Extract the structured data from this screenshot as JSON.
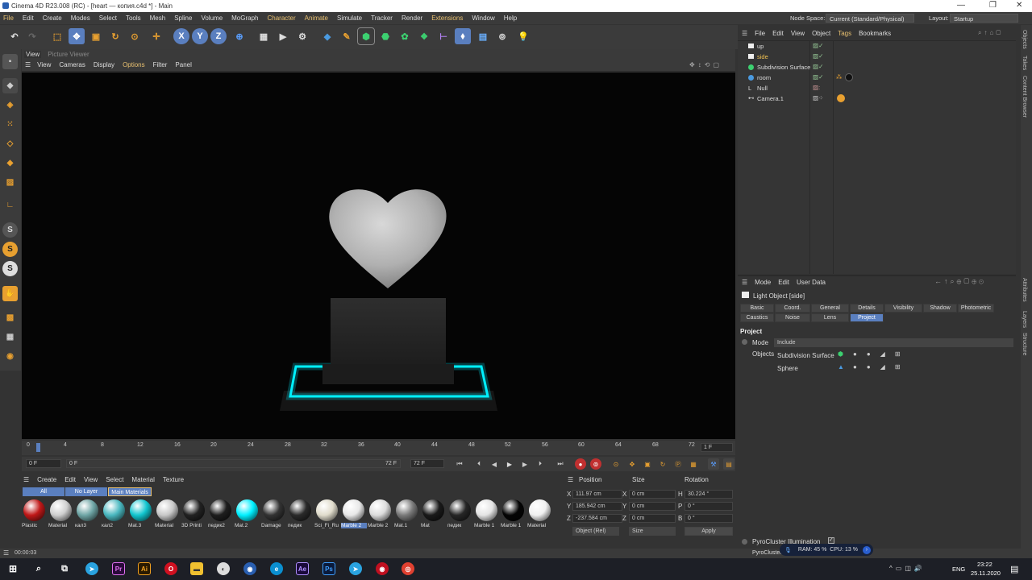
{
  "app": {
    "title": "Cinema 4D R23.008 (RC) - [heart — копия.c4d *] - Main",
    "window_controls": [
      "—",
      "❐",
      "✕"
    ]
  },
  "menu": [
    "File",
    "Edit",
    "Create",
    "Modes",
    "Select",
    "Tools",
    "Mesh",
    "Spline",
    "Volume",
    "MoGraph",
    "Character",
    "Animate",
    "Simulate",
    "Tracker",
    "Render",
    "Extensions",
    "Window",
    "Help"
  ],
  "node_space": {
    "label": "Node Space:",
    "value": "Current (Standard/Physical)"
  },
  "layout": {
    "label": "Layout:",
    "value": "Startup"
  },
  "toolbar": {
    "x": "X",
    "y": "Y",
    "z": "Z"
  },
  "view_tabs": [
    "View",
    "Picture Viewer"
  ],
  "view_menu": [
    "View",
    "Cameras",
    "Display",
    "Options",
    "Filter",
    "Panel"
  ],
  "timeline": {
    "ticks": [
      "0",
      "4",
      "8",
      "12",
      "16",
      "20",
      "24",
      "28",
      "32",
      "36",
      "40",
      "44",
      "48",
      "52",
      "56",
      "60",
      "64",
      "68",
      "72"
    ],
    "current_frame": "1 F"
  },
  "playbar": {
    "start": "0 F",
    "min": "0 F",
    "max": "72 F",
    "end": "72 F"
  },
  "materials": {
    "menu": [
      "Create",
      "Edit",
      "View",
      "Select",
      "Material",
      "Texture"
    ],
    "filters": [
      "All",
      "No Layer",
      "Main Materials"
    ],
    "items": [
      {
        "name": "Plastic",
        "color": "#c01818"
      },
      {
        "name": "Material",
        "color": "#cfcfcf"
      },
      {
        "name": "кал3",
        "color": "#6fa6a6"
      },
      {
        "name": "кал2",
        "color": "#4ab8c0"
      },
      {
        "name": "Mat.3",
        "color": "#12c6cf"
      },
      {
        "name": "Material",
        "color": "#c8c8c8"
      },
      {
        "name": "3D Printi",
        "color": "#222222"
      },
      {
        "name": "педик2",
        "color": "#1e1e1e"
      },
      {
        "name": "Mat.2",
        "color": "#00f0ff"
      },
      {
        "name": "Damage",
        "color": "#333333"
      },
      {
        "name": "педик",
        "color": "#2a2a2a"
      },
      {
        "name": "Sci_Fi_Ru",
        "color": "#e0dccc"
      },
      {
        "name": "Marble 2",
        "color": "#e8e8e8"
      },
      {
        "name": "Marble 2",
        "color": "#dcdcdc"
      },
      {
        "name": "Mat.1",
        "color": "#7a7a7a"
      },
      {
        "name": "Mat",
        "color": "#1a1a1a"
      },
      {
        "name": "педик",
        "color": "#262626"
      },
      {
        "name": "Marble 1",
        "color": "#e4e4e4"
      },
      {
        "name": "Marble 1",
        "color": "#050505"
      },
      {
        "name": "Material",
        "color": "#f0f0f0"
      }
    ]
  },
  "coords": {
    "headers": [
      "Position",
      "Size",
      "Rotation"
    ],
    "rows": [
      {
        "a": "X",
        "pos": "111.97 cm",
        "b": "X",
        "size": "0 cm",
        "c": "H",
        "rot": "30.224 °"
      },
      {
        "a": "Y",
        "pos": "185.942 cm",
        "b": "Y",
        "size": "0 cm",
        "c": "P",
        "rot": "0 °"
      },
      {
        "a": "Z",
        "pos": "-237.584 cm",
        "b": "Z",
        "size": "0 cm",
        "c": "B",
        "rot": "0 °"
      }
    ],
    "mode": "Object (Rel)",
    "size_mode": "Size",
    "apply": "Apply"
  },
  "objects": {
    "menu": [
      "File",
      "Edit",
      "View",
      "Object",
      "Tags",
      "Bookmarks"
    ],
    "items": [
      {
        "name": "up",
        "color": "#dddddd"
      },
      {
        "name": "side",
        "color": "#f0c050"
      },
      {
        "name": "Subdivision Surface",
        "color": "#dddddd"
      },
      {
        "name": "room",
        "color": "#dddddd"
      },
      {
        "name": "Null",
        "color": "#dddddd"
      },
      {
        "name": "Camera.1",
        "color": "#dddddd"
      }
    ]
  },
  "attributes": {
    "menu": [
      "Mode",
      "Edit",
      "User Data"
    ],
    "object": "Light Object [side]",
    "tabs1": [
      "Basic",
      "Coord.",
      "General",
      "Details",
      "Visibility",
      "Shadow",
      "Photometric"
    ],
    "tabs2": [
      "Caustics",
      "Noise",
      "Lens",
      "Project"
    ],
    "section": "Project",
    "mode_label": "Mode",
    "mode_value": "Include",
    "objects_label": "Objects",
    "object_list": [
      "Subdivision Surface",
      "Sphere"
    ],
    "bottom": [
      "PyroCluster Illumination",
      "PyroCluster"
    ]
  },
  "side_tabs": [
    "Objects",
    "Takes",
    "Content Browser",
    "Attributes",
    "Layers",
    "Structure"
  ],
  "status": {
    "time": "00:00:03",
    "ram": "RAM: 45 %",
    "cpu": "CPU: 13 %"
  },
  "taskbar": {
    "lang": "ENG",
    "time": "23:22",
    "date": "25.11.2020"
  }
}
